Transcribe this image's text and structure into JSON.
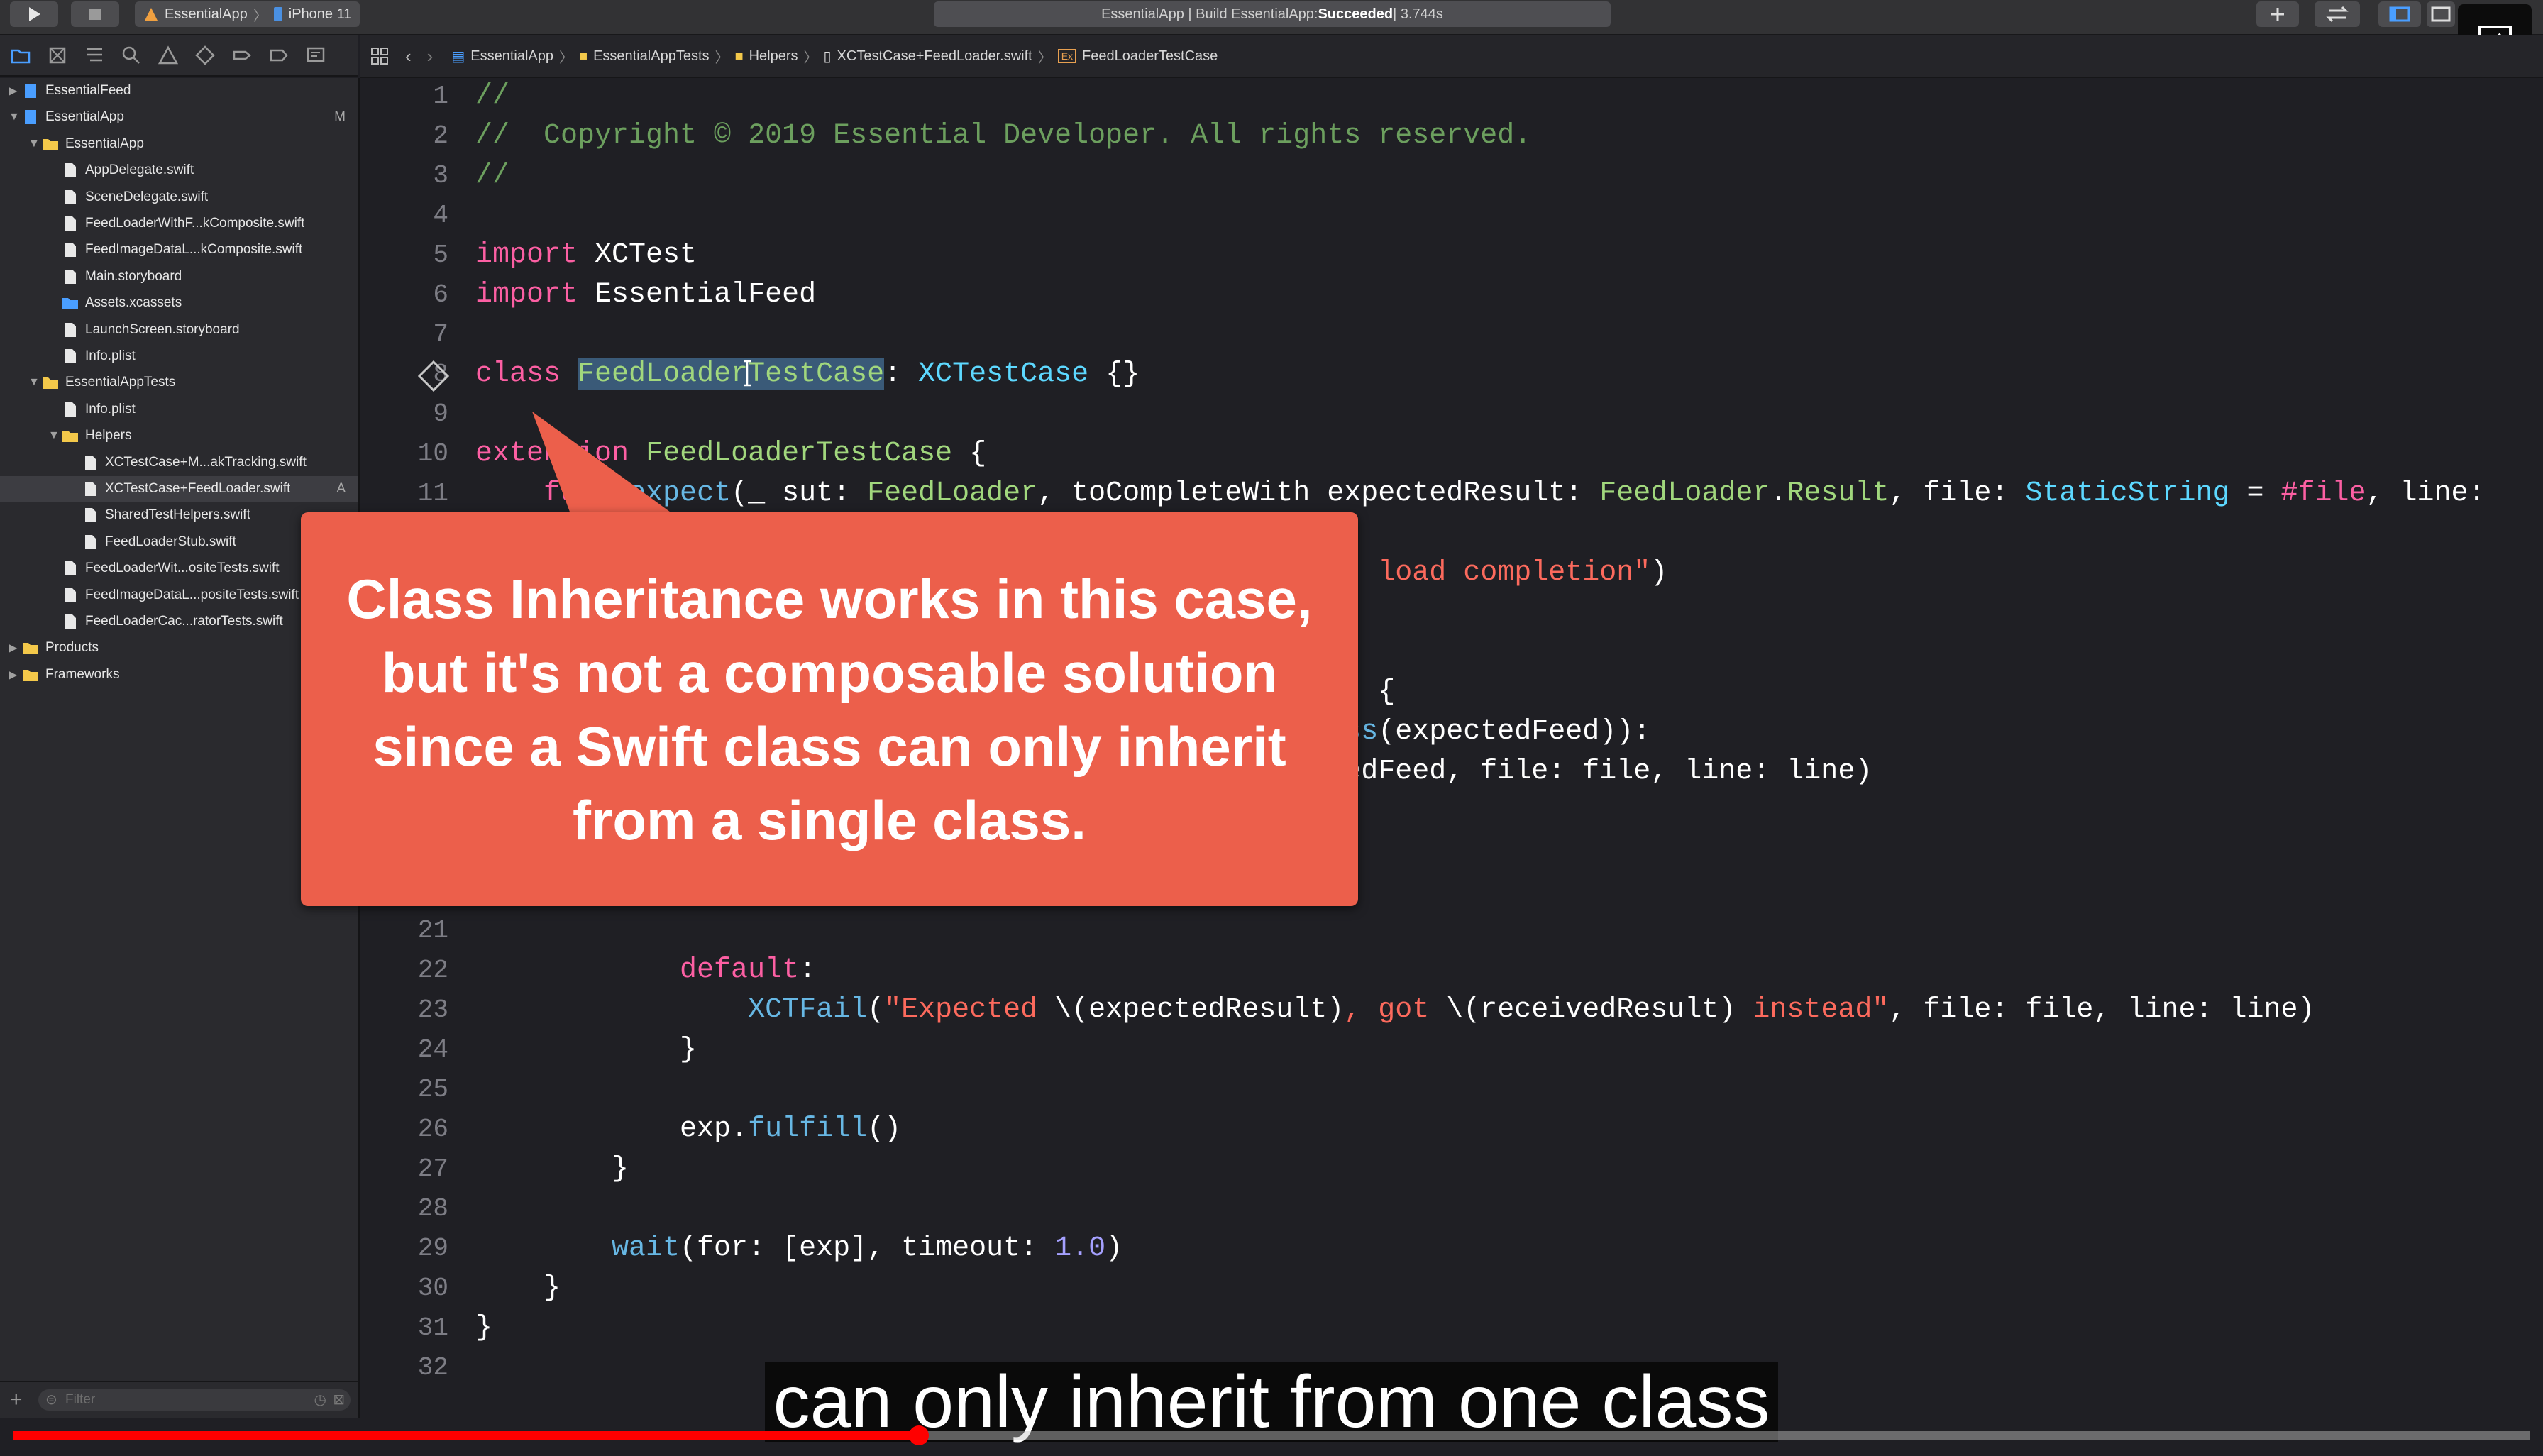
{
  "titlebar": {
    "scheme_app": "EssentialApp",
    "scheme_device": "iPhone 11",
    "activity_prefix": "EssentialApp | Build EssentialApp: ",
    "activity_status": "Succeeded",
    "activity_time": " | 3.744s"
  },
  "navigator": {
    "items": [
      {
        "label": "EssentialFeed",
        "indent": 0,
        "type": "project",
        "expanded": false,
        "badge": ""
      },
      {
        "label": "EssentialApp",
        "indent": 0,
        "type": "project",
        "expanded": true,
        "badge": "M"
      },
      {
        "label": "EssentialApp",
        "indent": 1,
        "type": "folder",
        "expanded": true,
        "badge": ""
      },
      {
        "label": "AppDelegate.swift",
        "indent": 2,
        "type": "file",
        "badge": ""
      },
      {
        "label": "SceneDelegate.swift",
        "indent": 2,
        "type": "file",
        "badge": ""
      },
      {
        "label": "FeedLoaderWithF...kComposite.swift",
        "indent": 2,
        "type": "file",
        "badge": ""
      },
      {
        "label": "FeedImageDataL...kComposite.swift",
        "indent": 2,
        "type": "file",
        "badge": ""
      },
      {
        "label": "Main.storyboard",
        "indent": 2,
        "type": "file",
        "badge": ""
      },
      {
        "label": "Assets.xcassets",
        "indent": 2,
        "type": "assets",
        "badge": ""
      },
      {
        "label": "LaunchScreen.storyboard",
        "indent": 2,
        "type": "file",
        "badge": ""
      },
      {
        "label": "Info.plist",
        "indent": 2,
        "type": "file",
        "badge": ""
      },
      {
        "label": "EssentialAppTests",
        "indent": 1,
        "type": "folder",
        "expanded": true,
        "badge": ""
      },
      {
        "label": "Info.plist",
        "indent": 2,
        "type": "file",
        "badge": ""
      },
      {
        "label": "Helpers",
        "indent": 2,
        "type": "folder",
        "expanded": true,
        "badge": ""
      },
      {
        "label": "XCTestCase+M...akTracking.swift",
        "indent": 3,
        "type": "file",
        "badge": ""
      },
      {
        "label": "XCTestCase+FeedLoader.swift",
        "indent": 3,
        "type": "file",
        "badge": "A",
        "selected": true
      },
      {
        "label": "SharedTestHelpers.swift",
        "indent": 3,
        "type": "file",
        "badge": ""
      },
      {
        "label": "FeedLoaderStub.swift",
        "indent": 3,
        "type": "file",
        "badge": ""
      },
      {
        "label": "FeedLoaderWit...ositeTests.swift",
        "indent": 2,
        "type": "file",
        "badge": ""
      },
      {
        "label": "FeedImageDataL...positeTests.swift",
        "indent": 2,
        "type": "file",
        "badge": ""
      },
      {
        "label": "FeedLoaderCac...ratorTests.swift",
        "indent": 2,
        "type": "file",
        "badge": ""
      },
      {
        "label": "Products",
        "indent": 0,
        "type": "folder",
        "expanded": false,
        "badge": ""
      },
      {
        "label": "Frameworks",
        "indent": 0,
        "type": "folder",
        "expanded": false,
        "badge": ""
      }
    ],
    "filter_placeholder": "Filter"
  },
  "jumpbar": {
    "crumbs": [
      "EssentialApp",
      "EssentialAppTests",
      "Helpers",
      "XCTestCase+FeedLoader.swift",
      "FeedLoaderTestCase"
    ]
  },
  "editor": {
    "line_numbers": [
      "1",
      "2",
      "3",
      "4",
      "5",
      "6",
      "7",
      "8",
      "9",
      "10",
      "11",
      "21",
      "22",
      "23",
      "24",
      "25",
      "26",
      "27",
      "28",
      "29",
      "30",
      "31",
      "32"
    ]
  },
  "callout": {
    "text": "Class Inheritance works in this case, but it's not a composable solution since a Swift class can only inherit from a single class."
  },
  "caption": {
    "text": "can only inherit from one class"
  },
  "video": {
    "progress_fraction": 0.36
  },
  "colors": {
    "keyword": "#fc5fa3",
    "comment": "#6c9f5e",
    "type": "#5dd8ff",
    "string": "#fc6a5d",
    "callout": "#ec5f4b",
    "progress": "#ff0000"
  }
}
